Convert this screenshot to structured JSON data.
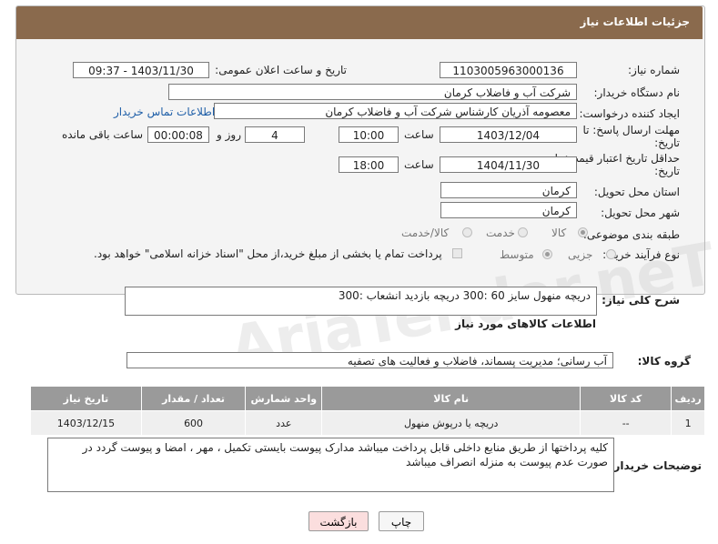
{
  "header": {
    "title": "جزئیات اطلاعات نیاز"
  },
  "fields": {
    "need_number_label": "شماره نیاز:",
    "need_number": "1103005963000136",
    "announce_label": "تاریخ و ساعت اعلان عمومی:",
    "announce_value": "1403/11/30 - 09:37",
    "buyer_label": "نام دستگاه خریدار:",
    "buyer_value": "شرکت آب و فاضلاب کرمان",
    "creator_label": "ایجاد کننده درخواست:",
    "creator_value": "معصومه آذریان کارشناس شرکت آب و فاضلاب کرمان",
    "contact_link": "اطلاعات تماس خریدار",
    "deadline_label_1": "مهلت ارسال پاسخ: تا",
    "deadline_label_2": "تاریخ:",
    "deadline_date": "1403/12/04",
    "time_label": "ساعت",
    "deadline_time": "10:00",
    "days_value": "4",
    "days_label": "روز و",
    "remaining_value": "00:00:08",
    "remaining_label": "ساعت باقی مانده",
    "validity_label_1": "حداقل تاریخ اعتبار قیمت: تا",
    "validity_label_2": "تاریخ:",
    "validity_date": "1404/11/30",
    "validity_time": "18:00",
    "province_label": "استان محل تحویل:",
    "province_value": "کرمان",
    "city_label": "شهر محل تحویل:",
    "city_value": "کرمان",
    "category_label": "طبقه بندی موضوعی:",
    "category_options": [
      "کالا",
      "خدمت",
      "کالا/خدمت"
    ],
    "process_label": "نوع فرآیند خرید :",
    "process_options": [
      "جزیی",
      "متوسط"
    ],
    "payment_note": "پرداخت تمام یا بخشی از مبلغ خرید،از محل \"اسناد خزانه اسلامی\" خواهد بود."
  },
  "description": {
    "label": "شرح کلی نیاز:",
    "value": "دریچه منهول سایز 60 :300   دریچه بازدید انشعاب :300"
  },
  "goods_section_title": "اطلاعات کالاهای مورد نیاز",
  "goods_group": {
    "label": "گروه کالا:",
    "value": "آب رسانی؛ مدیریت پسماند، فاضلاب و فعالیت های تصفیه"
  },
  "table": {
    "headers": [
      "ردیف",
      "کد کالا",
      "نام کالا",
      "واحد شمارش",
      "تعداد / مقدار",
      "تاریخ نیاز"
    ],
    "rows": [
      [
        "1",
        "--",
        "دریچه یا درپوش منهول",
        "عدد",
        "600",
        "1403/12/15"
      ]
    ]
  },
  "buyer_notes": {
    "label": "توضیحات خریدار:",
    "value": "کلیه پرداختها از طریق منابع داخلی قابل پرداخت میباشد مدارک پیوست بایستی تکمیل ، مهر ، امضا و پیوست گردد در صورت عدم پیوست به منزله انصراف میباشد"
  },
  "buttons": {
    "print": "چاپ",
    "back": "بازگشت"
  },
  "watermark": "AriaTender.neT"
}
